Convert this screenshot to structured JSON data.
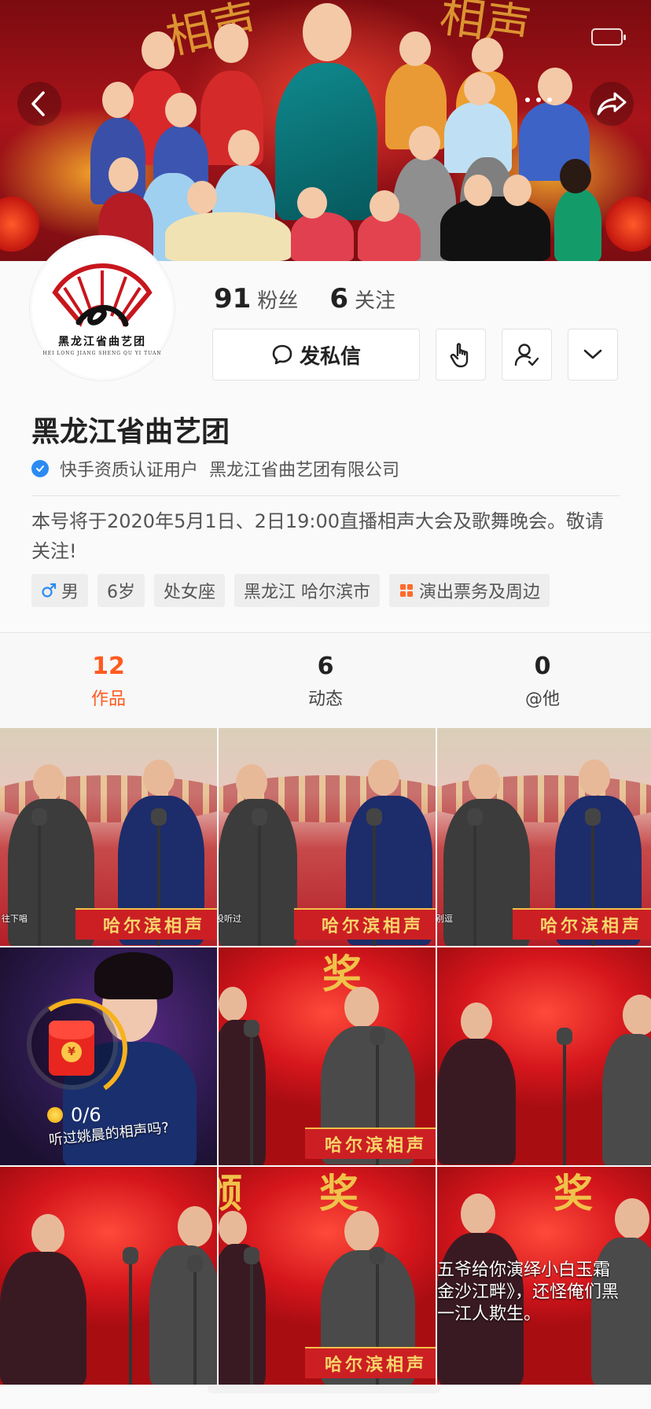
{
  "profile": {
    "name": "黑龙江省曲艺团",
    "avatar_text": "黑龙江省曲艺团",
    "avatar_subtext": "HEI LONG JIANG SHENG QU YI TUAN",
    "fans_count": "91",
    "fans_label": "粉丝",
    "following_count": "6",
    "following_label": "关注",
    "verify_text": "快手资质认证用户  黑龙江省曲艺团有限公司",
    "bio": "本号将于2020年5月1日、2日19:00直播相声大会及歌舞晚会。敬请关注!"
  },
  "actions": {
    "message_label": "发私信"
  },
  "tags": [
    {
      "label": "男",
      "icon": "male-icon"
    },
    {
      "label": "6岁"
    },
    {
      "label": "处女座"
    },
    {
      "label": "黑龙江 哈尔滨市"
    },
    {
      "label": "演出票务及周边",
      "icon": "grid-icon"
    }
  ],
  "tabs": [
    {
      "count": "12",
      "label": "作品",
      "active": true
    },
    {
      "count": "6",
      "label": "动态",
      "active": false
    },
    {
      "count": "0",
      "label": "@他",
      "active": false
    }
  ],
  "banner_chars": {
    "left": "相声",
    "right": "相声"
  },
  "videos": {
    "stage_banner": "哈尔滨相声",
    "sub1": "往下唱",
    "sub2": "没听过",
    "sub3": "别逗",
    "award_char": "奖",
    "award_char2": "颁",
    "caption": "五爷给你演绎小白玉霜\n金沙江畔》，还怪俺们黑\n一江人欺生。"
  },
  "redpacket": {
    "progress": "0/6",
    "question": "听过姚晨的相声吗?"
  },
  "colors": {
    "accent": "#ff5a1f",
    "verify": "#2b8bf2"
  }
}
